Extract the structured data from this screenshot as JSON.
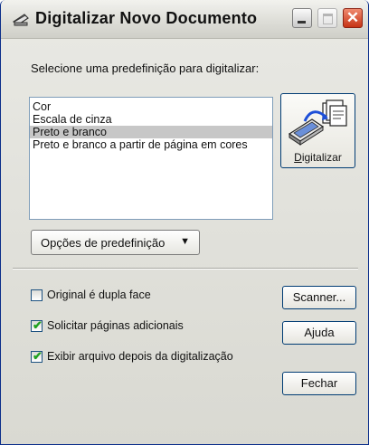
{
  "window": {
    "title": "Digitalizar Novo Documento",
    "close_glyph": "✕",
    "title_icon": "scanner-icon"
  },
  "prompt": "Selecione uma predefinição para digitalizar:",
  "presets": {
    "items": [
      "Cor",
      "Escala de cinza",
      "Preto e branco",
      "Preto e branco a partir de página em cores"
    ],
    "selected": "Preto e branco"
  },
  "scan_button": {
    "label_mnemonic": "D",
    "label_rest": "igitalizar",
    "icon": "scanner-icon"
  },
  "preset_options": {
    "label": "Opções de predefinição",
    "arrow": "▼"
  },
  "options": [
    {
      "label": "Original é dupla face",
      "checked": false
    },
    {
      "label": "Solicitar páginas adicionais",
      "checked": true
    },
    {
      "label": "Exibir arquivo depois da digitalização",
      "checked": true
    }
  ],
  "buttons": {
    "scanner": "Scanner...",
    "help": "Ajuda",
    "close": "Fechar"
  },
  "check_glyph": "✔",
  "colors": {
    "selection": "#c7c7c7",
    "button_border": "#003c74",
    "close_red": "#c63315",
    "check_green": "#21a121"
  }
}
